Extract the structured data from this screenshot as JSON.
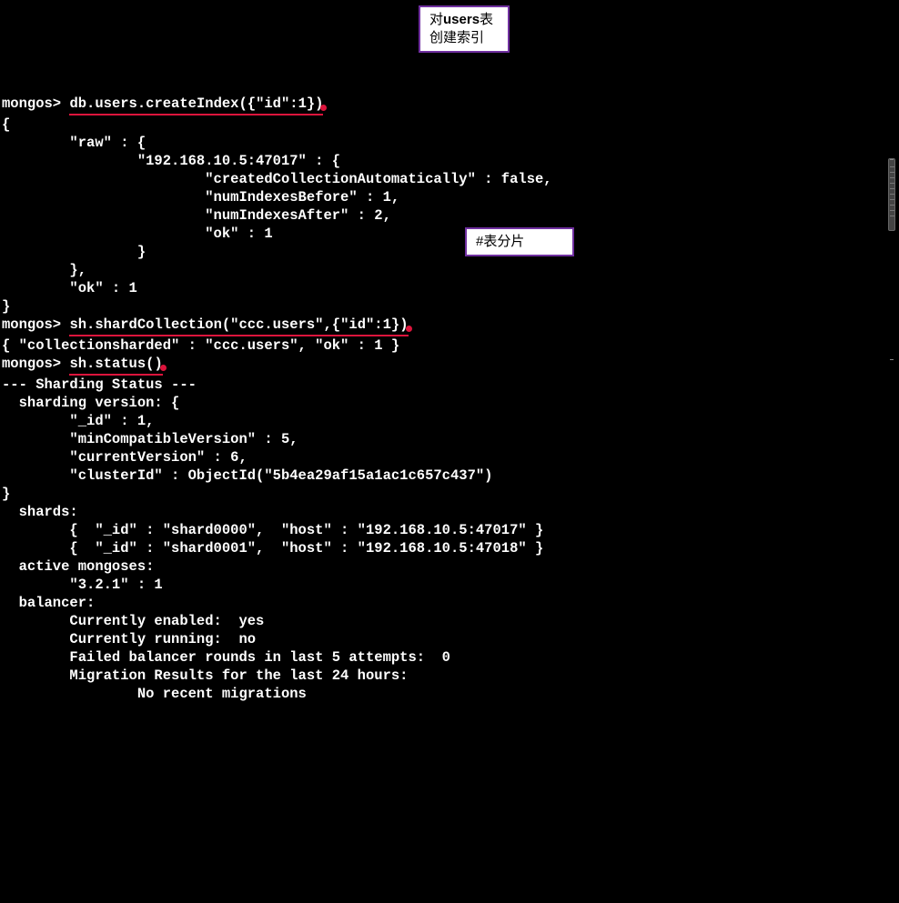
{
  "prompt": "mongos>",
  "cmd1": "db.users.createIndex({\"id\":1})",
  "callout1_line1_pre": "对",
  "callout1_line1_bold": "users",
  "callout1_line1_post": "表",
  "callout1_line2": "创建索引",
  "out1_l1": "{",
  "out1_l2": "        \"raw\" : {",
  "out1_l3": "                \"192.168.10.5:47017\" : {",
  "out1_l4": "                        \"createdCollectionAutomatically\" : false,",
  "out1_l5": "                        \"numIndexesBefore\" : 1,",
  "out1_l6": "                        \"numIndexesAfter\" : 2,",
  "out1_l7": "                        \"ok\" : 1",
  "out1_l8": "                }",
  "out1_l9": "        },",
  "out1_l10": "        \"ok\" : 1",
  "out1_l11": "}",
  "cmd2": "sh.shardCollection(\"ccc.users\",{\"id\":1})",
  "callout2": "#表分片",
  "out2_l1": "{ \"collectionsharded\" : \"ccc.users\", \"ok\" : 1 }",
  "cmd3": "sh.status()",
  "out3_l1": "--- Sharding Status ---",
  "out3_l2": "  sharding version: {",
  "out3_l3": "        \"_id\" : 1,",
  "out3_l4": "        \"minCompatibleVersion\" : 5,",
  "out3_l5": "        \"currentVersion\" : 6,",
  "out3_l6": "        \"clusterId\" : ObjectId(\"5b4ea29af15a1ac1c657c437\")",
  "out3_l7": "}",
  "out3_l8": "  shards:",
  "out3_l9": "        {  \"_id\" : \"shard0000\",  \"host\" : \"192.168.10.5:47017\" }",
  "out3_l10": "        {  \"_id\" : \"shard0001\",  \"host\" : \"192.168.10.5:47018\" }",
  "out3_l11": "  active mongoses:",
  "out3_l12": "        \"3.2.1\" : 1",
  "out3_l13": "  balancer:",
  "out3_l14": "        Currently enabled:  yes",
  "out3_l15": "        Currently running:  no",
  "out3_l16": "        Failed balancer rounds in last 5 attempts:  0",
  "out3_l17": "        Migration Results for the last 24 hours:",
  "out3_l18": "                No recent migrations"
}
